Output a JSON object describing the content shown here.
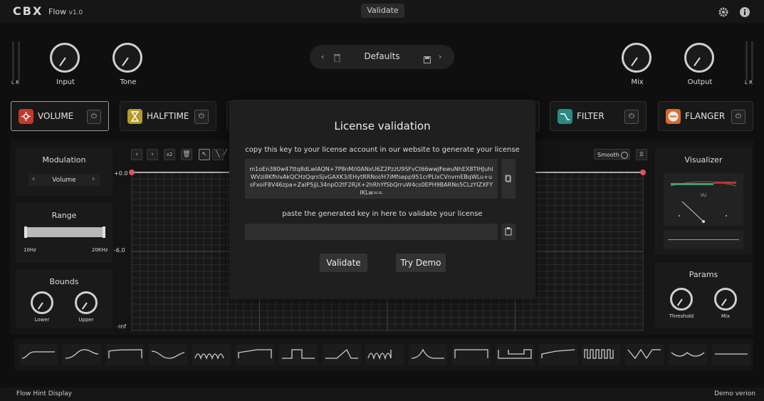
{
  "app": {
    "logo": "CBX",
    "title": "Flow",
    "version": "v1.0",
    "validate_label": "Validate"
  },
  "icons": {
    "settings": "gear-icon",
    "info": "info-icon"
  },
  "meters": {
    "left": "L R",
    "right": "L R"
  },
  "knobs": {
    "input": "Input",
    "tone": "Tone",
    "mix": "Mix",
    "output": "Output"
  },
  "preset": {
    "name": "Defaults"
  },
  "effects": [
    {
      "label": "VOLUME",
      "color": "#c0392b"
    },
    {
      "label": "HALFTIME",
      "color": "#b59b2a"
    },
    {
      "label": "FILTER",
      "color": "#2a8a86"
    },
    {
      "label": "FLANGER",
      "color": "#d86a2c"
    }
  ],
  "modulation": {
    "title": "Modulation",
    "target": "Volume"
  },
  "range": {
    "title": "Range",
    "min": "10Hz",
    "max": "20KHz"
  },
  "bounds": {
    "title": "Bounds",
    "lower": "Lower",
    "upper": "Upper"
  },
  "editor": {
    "multiplier": "x2",
    "smooth": "Smooth",
    "db_top": "+0.0",
    "db_mid": "-6.0",
    "db_bottom": "-inf"
  },
  "visualizer": {
    "title": "Visualizer",
    "vu": "VU"
  },
  "params": {
    "title": "Params",
    "threshold": "Threshold",
    "mix": "Mix"
  },
  "dialog": {
    "title": "License validation",
    "copy_instruction": "copy this key to your license account in our website to generate your license",
    "license_key": "m1oEn380w47ttq8dLwIAQN+7P8nM/i0ANxU6Z2PzzU9SFvCt66wwJFewuNhEX8TIHJuhIWVzi8KfhlvAkQCHzQqrsSjvGAXK3/EHytRRNoi/H7iMfsepp951crPLIxCVnvmEBqWLu+usFxoiF8V46zpa+ZaIP5jjL34npO2tF2RjX+2hRhYfSbQrruW4cs0EPH9BARNo5CLzYIZXFYIKLw==",
    "paste_instruction": "paste the generated key in here to validate your license",
    "paste_value": "",
    "validate_label": "Validate",
    "demo_label": "Try Demo"
  },
  "status": {
    "hint": "Flow Hint Display",
    "edition": "Demo verion"
  }
}
